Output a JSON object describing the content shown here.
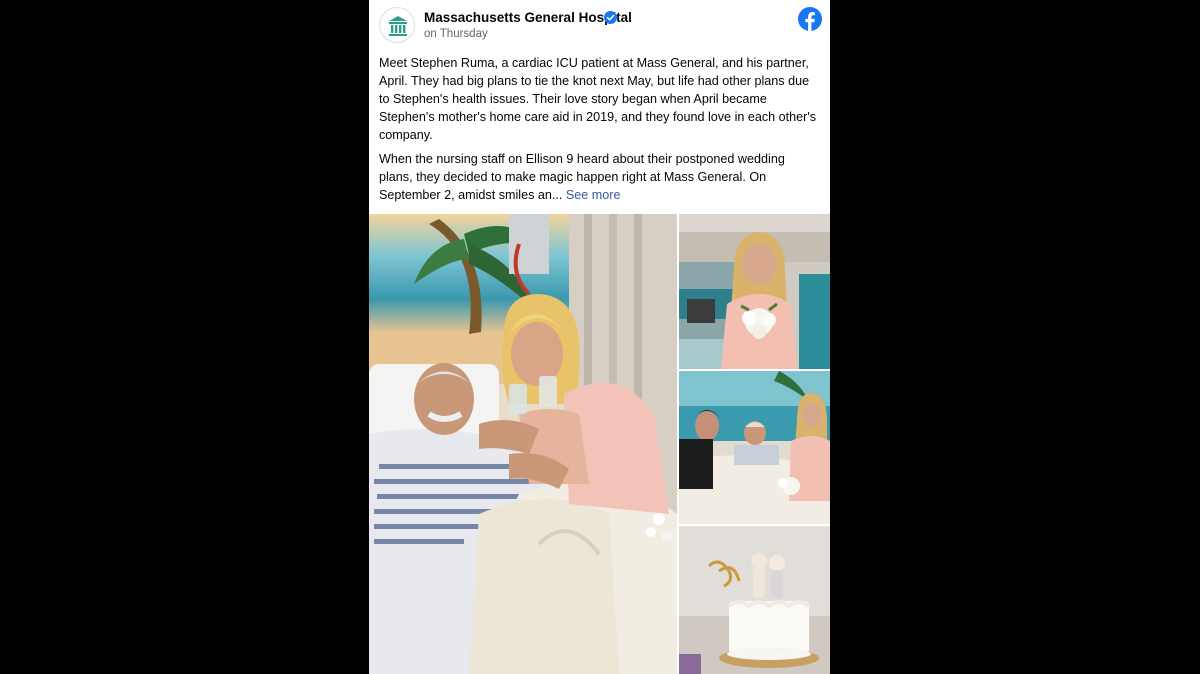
{
  "post": {
    "page_name": "Massachusetts General Hospital",
    "time": "on Thursday",
    "paragraph1": "Meet Stephen Ruma, a cardiac ICU patient at Mass General, and his partner, April. They had big plans to tie the knot next May, but life had other plans due to Stephen's health issues. Their love story began when April became Stephen's mother's home care aid in 2019, and they found love in each other's company.",
    "paragraph2": "When the nursing staff on Ellison 9 heard about their postponed wedding plans, they decided to make magic happen right at Mass General. On September 2, amidst smiles an...",
    "see_more": "See more"
  },
  "icons": {
    "avatar": "hospital-columns-logo",
    "verified": "verified-badge-icon",
    "brand": "facebook-logo-icon"
  },
  "colors": {
    "page_bg": "#000000",
    "card_bg": "#ffffff",
    "link": "#385898",
    "facebook_blue": "#1877f2",
    "logo_teal": "#2a9d8f",
    "secondary_text": "#65676b"
  }
}
